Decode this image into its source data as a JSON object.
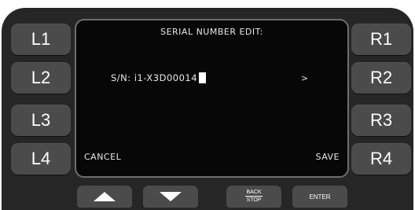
{
  "screen": {
    "title": "SERIAL NUMBER EDIT:",
    "serial_prefix": "S/N: ",
    "serial_value": "i1-X3D00014",
    "next_arrow": ">",
    "cancel_label": "CANCEL",
    "save_label": "SAVE"
  },
  "left_buttons": [
    "L1",
    "L2",
    "L3",
    "L4"
  ],
  "right_buttons": [
    "R1",
    "R2",
    "R3",
    "R4"
  ],
  "bottom_buttons": {
    "up_icon": "up-triangle-icon",
    "down_icon": "down-triangle-icon",
    "back_label": "BACK",
    "stop_label": "STOP",
    "enter_label": "ENTER"
  },
  "colors": {
    "bezel": "#262626",
    "button": "#4b4b4b",
    "screen_bg": "#070707",
    "screen_border": "#6e6e6e",
    "text": "#e8e8e8"
  }
}
